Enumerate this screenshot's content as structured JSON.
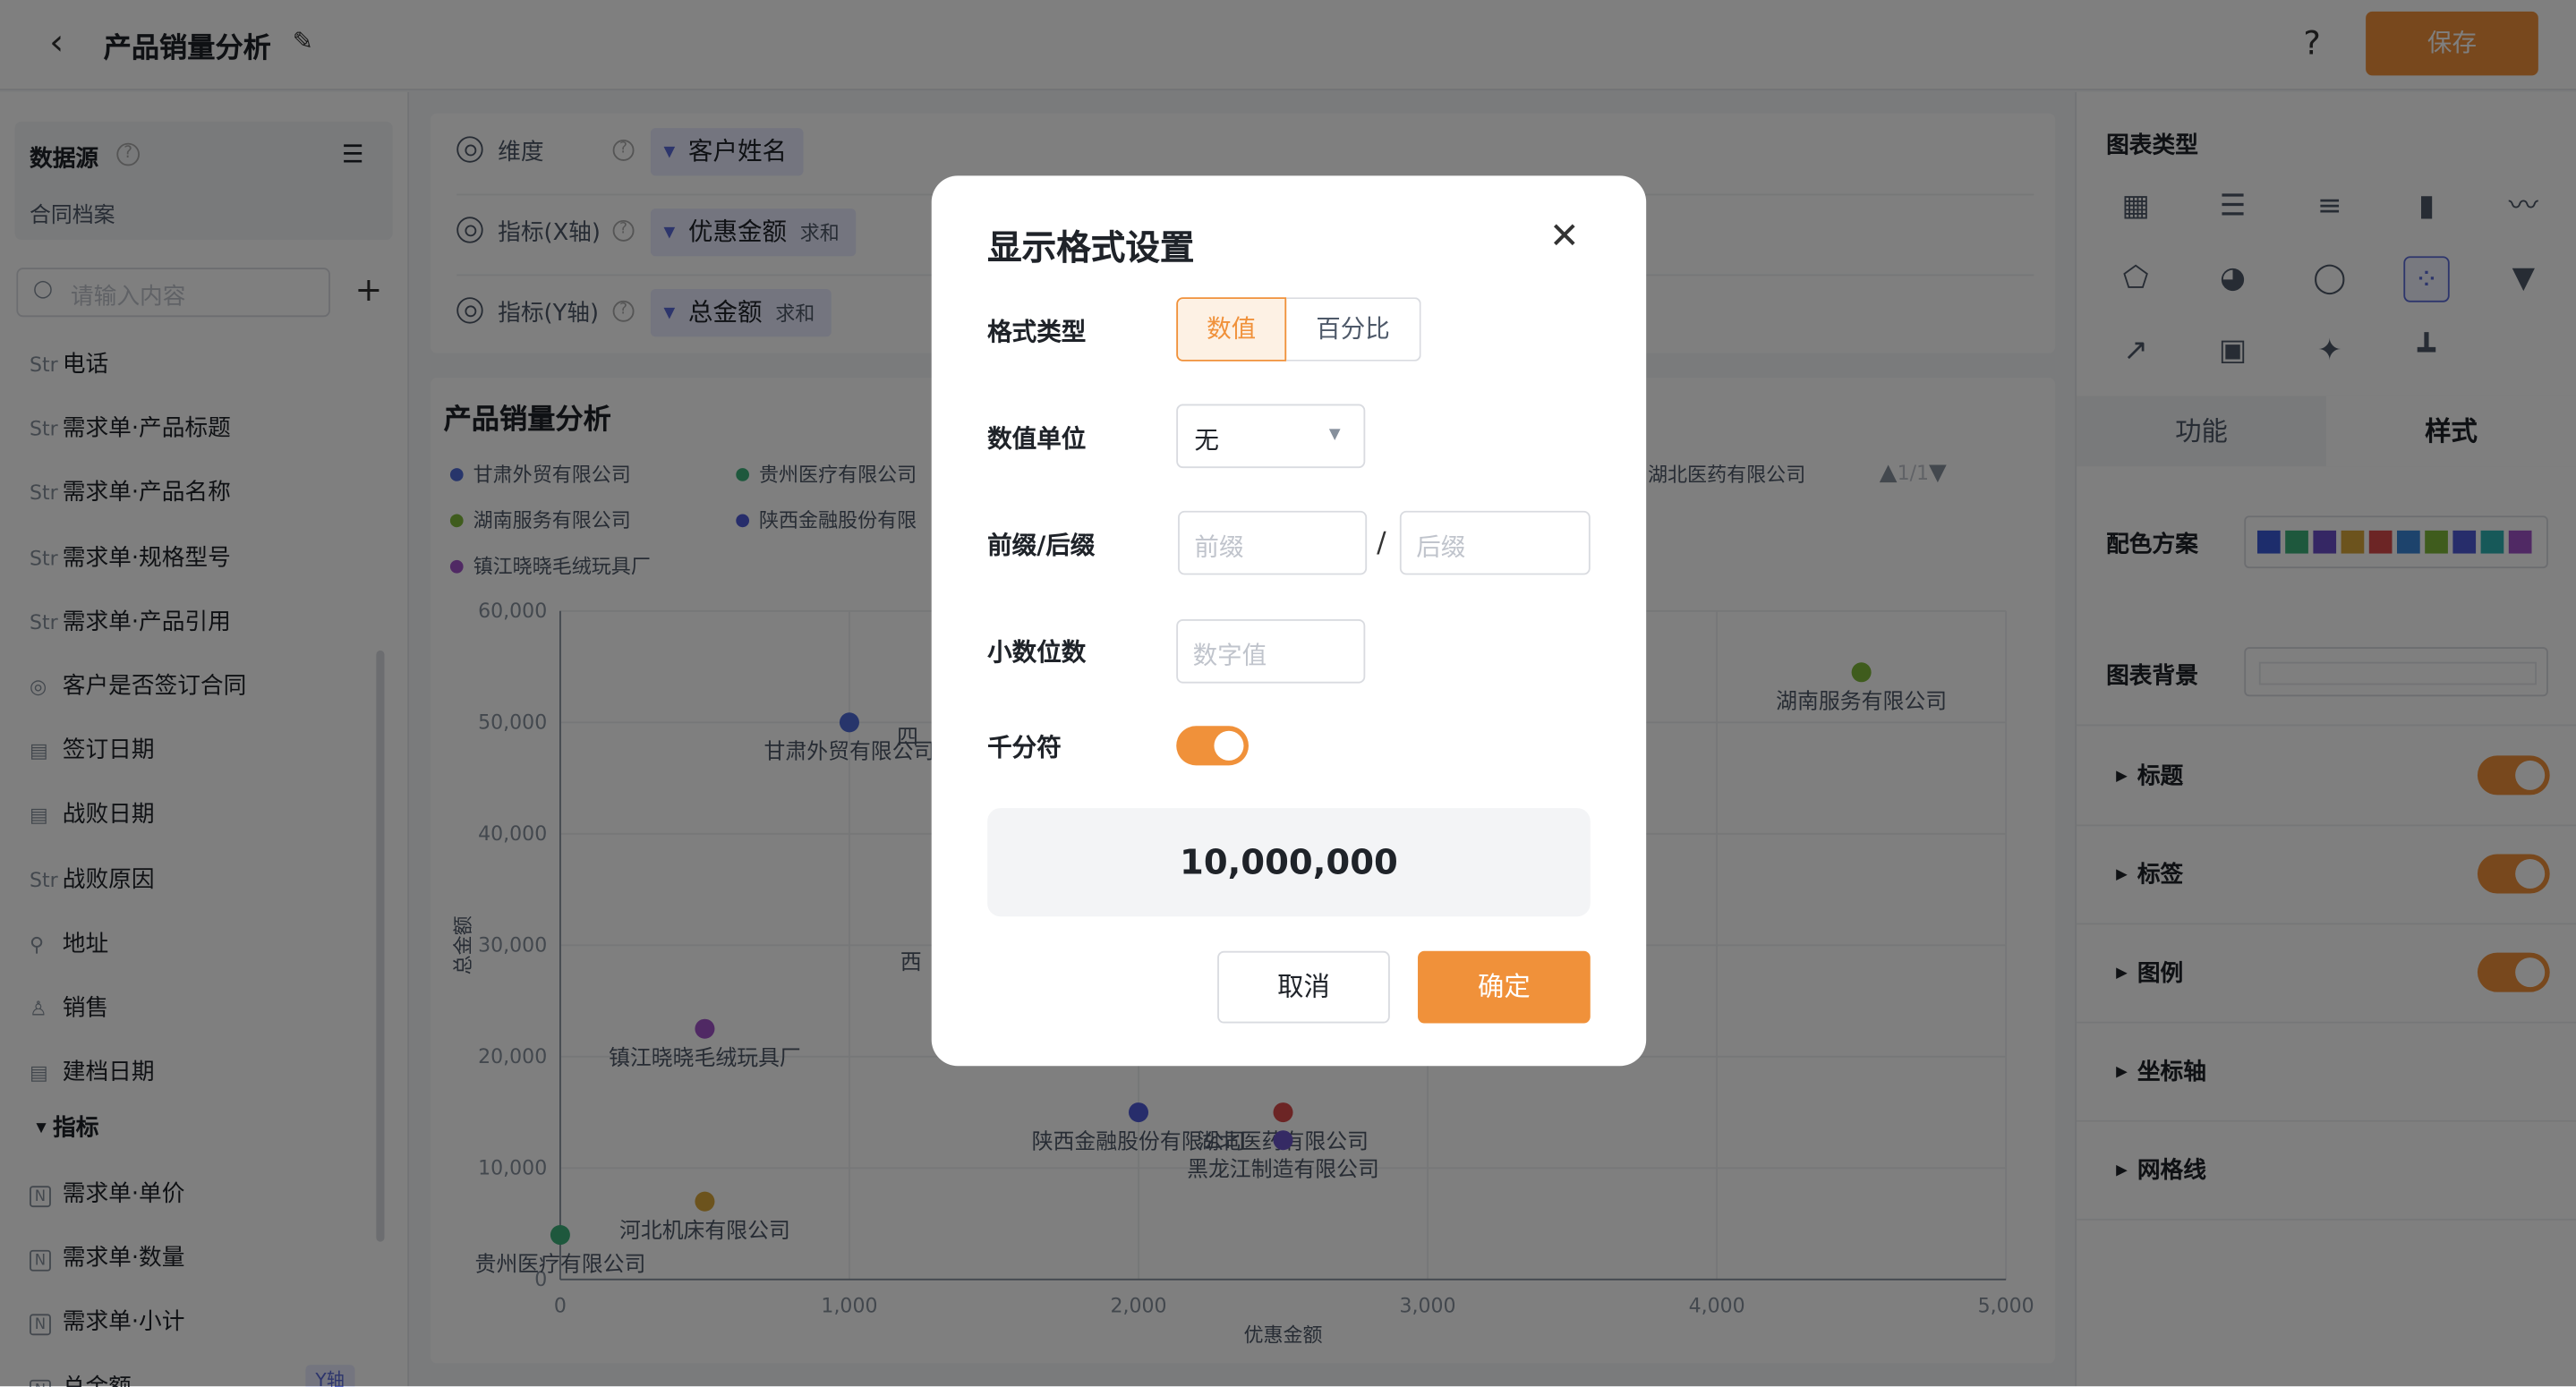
{
  "topbar": {
    "back_icon": "chevron-left-icon",
    "title": "产品销量分析",
    "edit_icon": "pencil-icon",
    "help": "?",
    "save_label": "保存"
  },
  "left": {
    "datasource_label": "数据源",
    "datasource_name": "合同档案",
    "search_placeholder": "请输入内容",
    "fields": [
      {
        "type": "Str",
        "label": "电话"
      },
      {
        "type": "Str",
        "label": "需求单·产品标题"
      },
      {
        "type": "Str",
        "label": "需求单·产品名称"
      },
      {
        "type": "Str",
        "label": "需求单·规格型号"
      },
      {
        "type": "Str",
        "label": "需求单·产品引用"
      },
      {
        "type": "◎",
        "label": "客户是否签订合同"
      },
      {
        "type": "▤",
        "label": "签订日期"
      },
      {
        "type": "▤",
        "label": "战败日期"
      },
      {
        "type": "Str",
        "label": "战败原因"
      },
      {
        "type": "⚲",
        "label": "地址"
      },
      {
        "type": "♙",
        "label": "销售"
      },
      {
        "type": "▤",
        "label": "建档日期"
      }
    ],
    "group_label": "指标",
    "metrics": [
      {
        "type": "N",
        "label": "需求单·单价"
      },
      {
        "type": "N",
        "label": "需求单·数量"
      },
      {
        "type": "N",
        "label": "需求单·小计"
      },
      {
        "type": "N",
        "label": "总金额"
      }
    ],
    "yaxis_tag": "Y轴"
  },
  "config": {
    "dimension_label": "维度",
    "dimension_value": "客户姓名",
    "x_label": "指标(X轴)",
    "x_value": "优惠金额",
    "x_agg": "求和",
    "y_label": "指标(Y轴)",
    "y_value": "总金额",
    "y_agg": "求和"
  },
  "chart_title": "产品销量分析",
  "legend": [
    {
      "name": "甘肃外贸有限公司",
      "color": "#4e6ad6"
    },
    {
      "name": "贵州医疗有限公司",
      "color": "#3db07a"
    },
    {
      "name": "湖北医药有限公司",
      "color": "#8c8c8c"
    },
    {
      "name": "湖南服务有限公司",
      "color": "#7fb83a"
    },
    {
      "name": "陕西金融股份有限",
      "color": "#4e5bd6"
    },
    {
      "name": "镇江晓晓毛绒玩具厂",
      "color": "#a052c8"
    }
  ],
  "pager": "1/1",
  "chart_data": {
    "type": "scatter",
    "xlabel": "优惠金额",
    "ylabel": "总金额",
    "xlim": [
      0,
      5000
    ],
    "ylim": [
      0,
      60000
    ],
    "xticks": [
      "0",
      "1,000",
      "2,000",
      "3,000",
      "4,000",
      "5,000"
    ],
    "yticks": [
      "0",
      "10,000",
      "20,000",
      "30,000",
      "40,000",
      "50,000",
      "60,000"
    ],
    "points": [
      {
        "name": "甘肃外贸有限公司",
        "x": 1000,
        "y": 50000,
        "color": "#4e6ad6"
      },
      {
        "name": "湖南服务有限公司",
        "x": 4500,
        "y": 54500,
        "color": "#7fb83a"
      },
      {
        "name": "镇江晓晓毛绒玩具厂",
        "x": 500,
        "y": 22500,
        "color": "#a052c8"
      },
      {
        "name": "河北机床有限公司",
        "x": 500,
        "y": 7000,
        "color": "#d9a63a"
      },
      {
        "name": "贵州医疗有限公司",
        "x": 0,
        "y": 4000,
        "color": "#3db07a"
      },
      {
        "name": "陕西金融股份有限公司",
        "x": 2000,
        "y": 15000,
        "color": "#4e5bd6"
      },
      {
        "name": "湖北医药有限公司",
        "x": 2500,
        "y": 15000,
        "color": "#d94a4a"
      },
      {
        "name": "黑龙江制造有限公司",
        "x": 2500,
        "y": 12500,
        "color": "#6a55c8"
      }
    ],
    "partial_labels": [
      "四",
      "西"
    ]
  },
  "right": {
    "chart_type_label": "图表类型",
    "tab_function": "功能",
    "tab_style": "样式",
    "palette_label": "配色方案",
    "palette_colors": [
      "#3a5bd9",
      "#3db07a",
      "#6a4fc8",
      "#d9a63a",
      "#d94a4a",
      "#3a86d9",
      "#7fb83a",
      "#4e5bd6",
      "#2fb3b3",
      "#a052c8"
    ],
    "bg_label": "图表背景",
    "sections": [
      {
        "label": "标题",
        "toggle": true
      },
      {
        "label": "标签",
        "toggle": true
      },
      {
        "label": "图例",
        "toggle": true
      },
      {
        "label": "坐标轴",
        "toggle": false
      },
      {
        "label": "网格线",
        "toggle": false
      }
    ]
  },
  "modal": {
    "title": "显示格式设置",
    "format_type_label": "格式类型",
    "format_numeric": "数值",
    "format_percent": "百分比",
    "unit_label": "数值单位",
    "unit_value": "无",
    "affix_label": "前缀/后缀",
    "prefix_placeholder": "前缀",
    "suffix_placeholder": "后缀",
    "decimal_label": "小数位数",
    "decimal_placeholder": "数字值",
    "thousands_label": "千分符",
    "thousands_on": true,
    "preview": "10,000,000",
    "cancel": "取消",
    "confirm": "确定"
  }
}
